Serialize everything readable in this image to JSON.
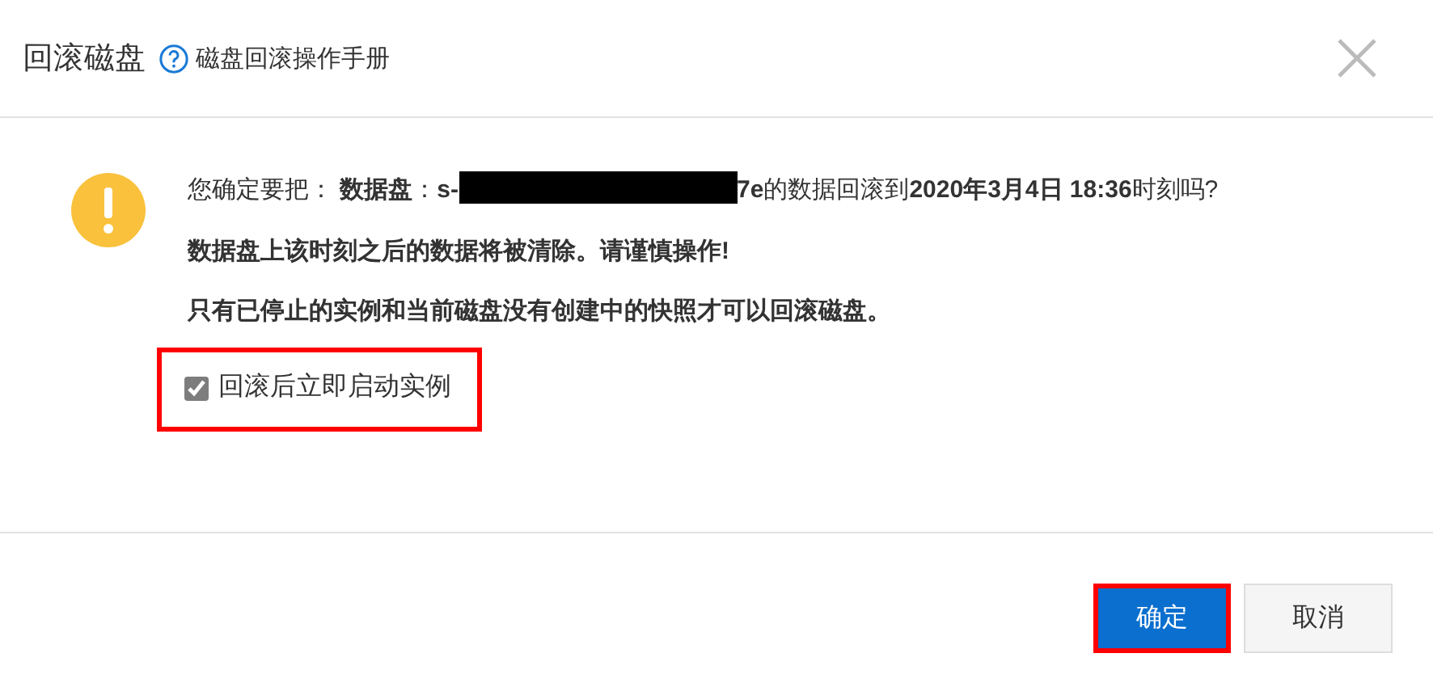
{
  "dialog": {
    "title": "回滚磁盘",
    "help_link": "磁盘回滚操作手册",
    "message": {
      "before": "您确定要把：  **数据盘**：**s-**",
      "redacted": true,
      "after": "**7e**的数据回滚到**2020年3月4日 18:36**时刻吗?"
    },
    "warnings": [
      "数据盘上该时刻之后的数据将被清除。请谨慎操作!",
      "只有已停止的实例和当前磁盘没有创建中的快照才可以回滚磁盘。"
    ],
    "option": {
      "label": "回滚后立即启动实例",
      "checked": true,
      "highlighted": true
    },
    "buttons": [
      {
        "label": "确定",
        "kind": "primary",
        "highlighted": true
      },
      {
        "label": "取消",
        "kind": "secondary",
        "highlighted": false
      }
    ]
  }
}
